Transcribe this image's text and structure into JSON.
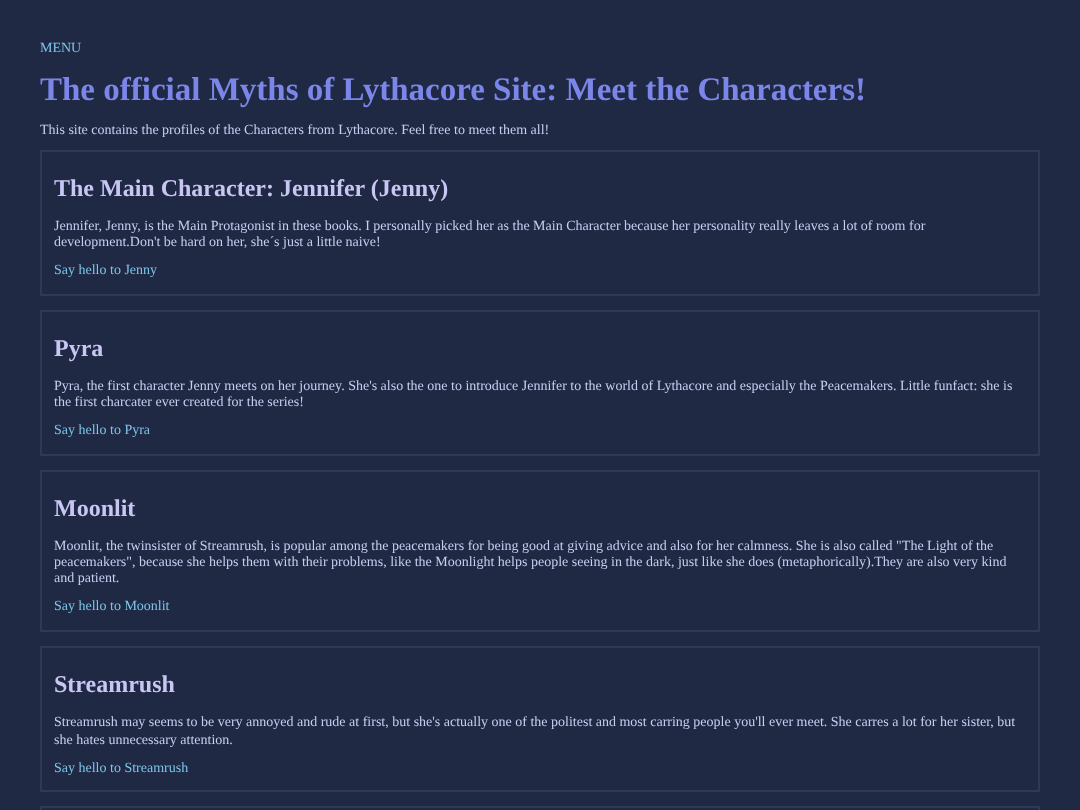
{
  "menu": "MENU",
  "title": "The official Myths of Lythacore Site: Meet the Characters!",
  "intro": "This site contains the profiles of the Characters from Lythacore. Feel free to meet them all!",
  "characters": [
    {
      "name": "The Main Character: Jennifer (Jenny)",
      "description": "Jennifer, Jenny, is the Main Protagonist in these books. I personally picked her as the Main Character because her personality really leaves a lot of room for development.Don't be hard on her, she´s just a little naive!",
      "link": "Say hello to Jenny"
    },
    {
      "name": "Pyra",
      "description": "Pyra, the first character Jenny meets on her journey. She's also the one to introduce Jennifer to the world of Lythacore and especially the Peacemakers. Little funfact: she is the first charcater ever created for the series!",
      "link": "Say hello to Pyra"
    },
    {
      "name": "Moonlit",
      "description": "Moonlit, the twinsister of Streamrush, is popular among the peacemakers for being good at giving advice and also for her calmness. She is also called \"The Light of the peacemakers\", because she helps them with their problems, like the Moonlight helps people seeing in the dark, just like she does (metaphorically).They are also very kind and patient.",
      "link": "Say hello to Moonlit"
    },
    {
      "name": "Streamrush",
      "description": "Streamrush may seems to be very annoyed and rude at first, but she's actually one of the politest and most carring people you'll ever meet. She carres a lot for her sister, but she hates unnecessary attention.",
      "link": "Say hello to Streamrush"
    }
  ]
}
